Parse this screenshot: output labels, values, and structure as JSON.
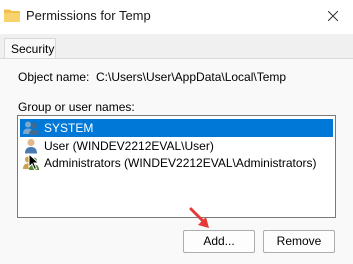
{
  "window": {
    "title": "Permissions for Temp"
  },
  "tabs": [
    {
      "label": "Security"
    }
  ],
  "object": {
    "label": "Object name:",
    "value": "C:\\Users\\User\\AppData\\Local\\Temp"
  },
  "group": {
    "label": "Group or user names:",
    "items": [
      {
        "label": "SYSTEM",
        "icon": "users-group-icon",
        "selected": true
      },
      {
        "label": "User (WINDEV2212EVAL\\User)",
        "icon": "user-icon",
        "selected": false
      },
      {
        "label": "Administrators (WINDEV2212EVAL\\Administrators)",
        "icon": "users-group-icon",
        "selected": false
      }
    ]
  },
  "buttons": {
    "add": "Add...",
    "remove": "Remove"
  },
  "colors": {
    "selection": "#0078d7",
    "arrow": "#e53935",
    "folder": "#f2c04a"
  }
}
